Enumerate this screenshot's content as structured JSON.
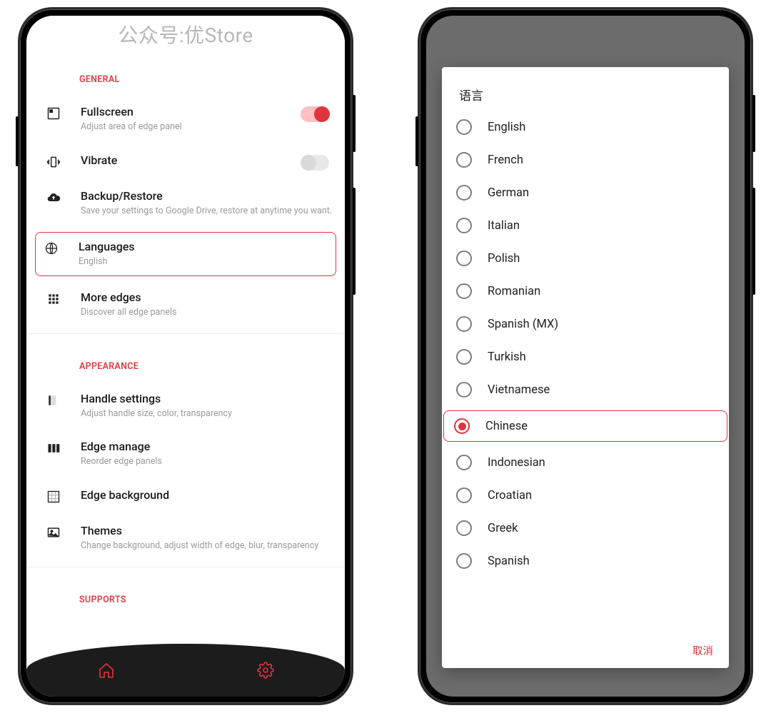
{
  "watermark": "公众号:优Store",
  "accent": "#e0343d",
  "left": {
    "sections": [
      {
        "header": "GENERAL",
        "items": [
          {
            "icon": "fullscreen-icon",
            "title": "Fullscreen",
            "subtitle": "Adjust area of edge panel",
            "toggle": true,
            "toggle_on": true
          },
          {
            "icon": "vibrate-icon",
            "title": "Vibrate",
            "subtitle": "",
            "toggle": true,
            "toggle_on": false
          },
          {
            "icon": "cloud-upload-icon",
            "title": "Backup/Restore",
            "subtitle": "Save your settings to Google Drive, restore at anytime you want."
          },
          {
            "icon": "globe-icon",
            "title": "Languages",
            "subtitle": "English",
            "highlighted": true
          },
          {
            "icon": "apps-grid-icon",
            "title": "More edges",
            "subtitle": "Discover all edge panels"
          }
        ]
      },
      {
        "header": "APPEARANCE",
        "items": [
          {
            "icon": "handle-icon",
            "title": "Handle settings",
            "subtitle": "Adjust handle size, color, transparency"
          },
          {
            "icon": "columns-icon",
            "title": "Edge manage",
            "subtitle": "Reorder edge panels"
          },
          {
            "icon": "pattern-icon",
            "title": "Edge background",
            "subtitle": ""
          },
          {
            "icon": "image-icon",
            "title": "Themes",
            "subtitle": "Change background, adjust width of edge, blur, transparency"
          }
        ]
      },
      {
        "header": "SUPPORTS",
        "items": []
      }
    ],
    "nav": {
      "home": "home-icon",
      "settings": "gear-icon"
    }
  },
  "right": {
    "dialog_title": "语言",
    "selected": "Chinese",
    "options": [
      "English",
      "French",
      "German",
      "Italian",
      "Polish",
      "Romanian",
      "Spanish (MX)",
      "Turkish",
      "Vietnamese",
      "Chinese",
      "Indonesian",
      "Croatian",
      "Greek",
      "Spanish"
    ],
    "cancel_label": "取消"
  }
}
